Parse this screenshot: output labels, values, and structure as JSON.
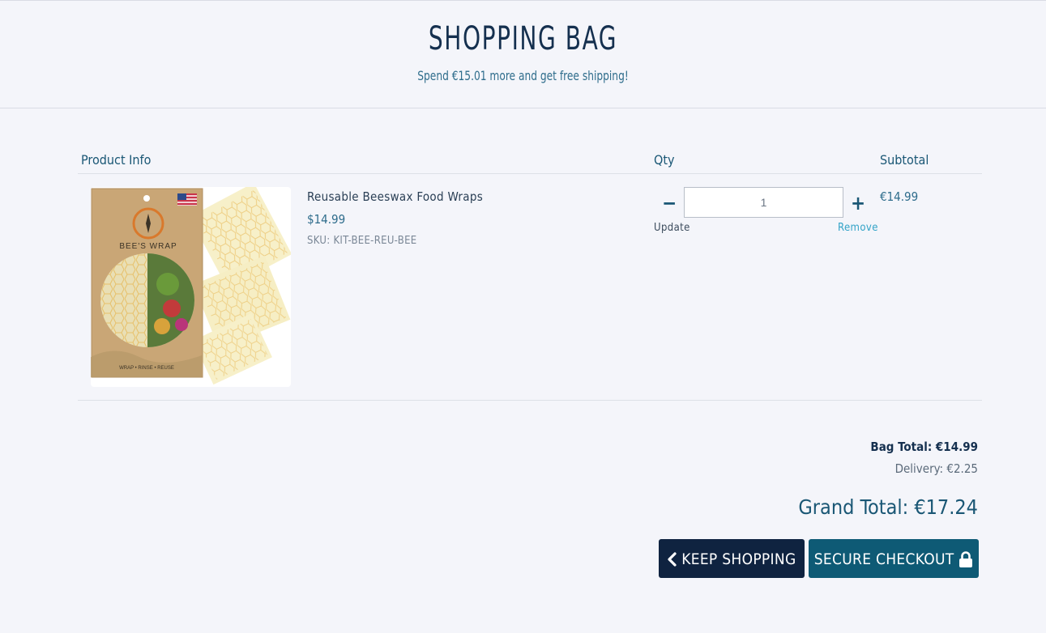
{
  "header": {
    "title": "SHOPPING BAG",
    "shipping_note": "Spend €15.01 more and get free shipping!"
  },
  "table": {
    "columns": {
      "product": "Product Info",
      "qty": "Qty",
      "subtotal": "Subtotal"
    }
  },
  "item": {
    "name": "Reusable Beeswax Food Wraps",
    "price": "$14.99",
    "sku": "SKU: KIT-BEE-REU-BEE",
    "quantity": "1",
    "update_label": "Update",
    "remove_label": "Remove",
    "minus_symbol": "−",
    "plus_symbol": "+",
    "subtotal": "€14.99",
    "image": {
      "brand": "BEE'S WRAP",
      "footer": "WRAP • RINSE • REUSE"
    }
  },
  "totals": {
    "bag_total": "Bag Total: €14.99",
    "delivery": "Delivery: €2.25",
    "grand_total": "Grand Total: €17.24"
  },
  "actions": {
    "keep_shopping": "KEEP SHOPPING",
    "secure_checkout": "SECURE CHECKOUT"
  },
  "colors": {
    "background": "#f4f5fa",
    "accent": "#1a5775",
    "keep_shopping_button": "#0f2340",
    "checkout_button": "#0e5a75",
    "remove_link": "#32a3c7"
  }
}
